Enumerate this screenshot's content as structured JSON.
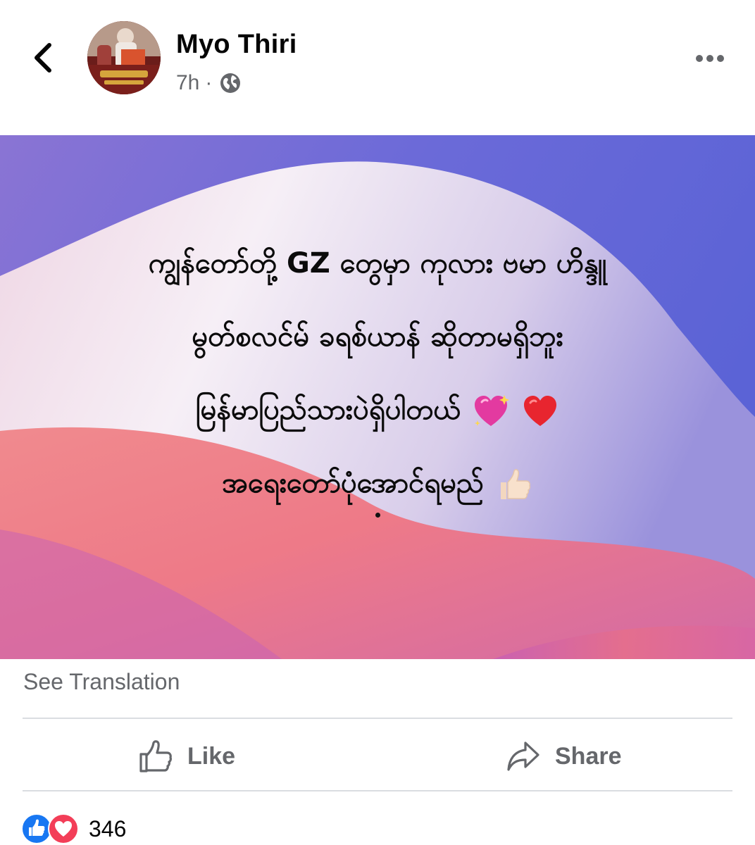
{
  "post": {
    "author": "Myo Thiri",
    "time": "7h",
    "separator": "·",
    "privacy_icon": "globe-icon",
    "lines": [
      "ကျွန်တော်တို့ GZ တွေမှာ ကုလား ဗမာ ဟိန္ဒူ",
      "မွတ်စလင်မ် ခရစ်ယာန် ဆိုတာမရှိဘူး",
      "မြန်မာပြည်သားပဲရှိပါတယ်",
      "အရေးတော်ပုံအောင်ရမည်"
    ],
    "line3_emojis": [
      "sparkling-heart-icon",
      "red-heart-icon"
    ],
    "line4_emoji": "thumbs-up-icon",
    "bg_colors": {
      "top": "#6c6cd8",
      "light": "#f3ecf6",
      "pink": "#ef7a86",
      "magenta": "#c964b4"
    }
  },
  "translation": {
    "label": "See Translation"
  },
  "actions": {
    "like_label": "Like",
    "share_label": "Share"
  },
  "reactions": {
    "count": "346",
    "icons": [
      "like-reaction-icon",
      "love-reaction-icon"
    ]
  },
  "colors": {
    "like_blue": "#1877f2",
    "love_red": "#f33e58",
    "secondary_text": "#65676b"
  }
}
